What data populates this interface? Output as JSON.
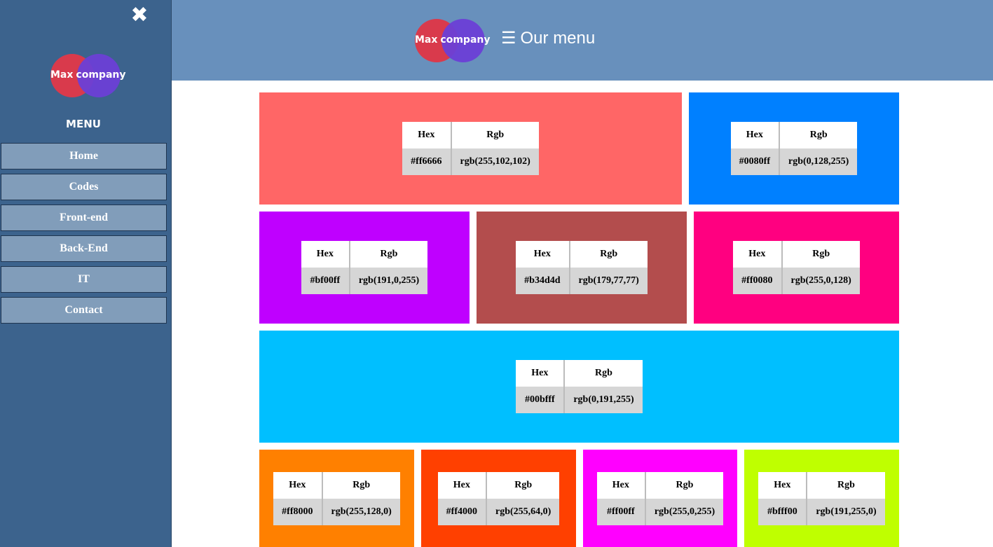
{
  "sidebar": {
    "close_icon": "✖",
    "logo": {
      "word1": "Max",
      "word2": "company"
    },
    "menu_title": "MENU",
    "items": [
      {
        "label": "Home"
      },
      {
        "label": "Codes"
      },
      {
        "label": "Front-end"
      },
      {
        "label": "Back-End"
      },
      {
        "label": "IT"
      },
      {
        "label": "Contact"
      }
    ]
  },
  "header": {
    "logo": {
      "word1": "Max",
      "word2": "company"
    },
    "menu_icon": "☰",
    "title": "Our menu"
  },
  "table_headers": {
    "hex": "Hex",
    "rgb": "Rgb"
  },
  "colors": [
    {
      "hex": "#ff6666",
      "rgb": "rgb(255,102,102)"
    },
    {
      "hex": "#0080ff",
      "rgb": "rgb(0,128,255)"
    },
    {
      "hex": "#bf00ff",
      "rgb": "rgb(191,0,255)"
    },
    {
      "hex": "#b34d4d",
      "rgb": "rgb(179,77,77)"
    },
    {
      "hex": "#ff0080",
      "rgb": "rgb(255,0,128)"
    },
    {
      "hex": "#00bfff",
      "rgb": "rgb(0,191,255)"
    },
    {
      "hex": "#ff8000",
      "rgb": "rgb(255,128,0)"
    },
    {
      "hex": "#ff4000",
      "rgb": "rgb(255,64,0)"
    },
    {
      "hex": "#ff00ff",
      "rgb": "rgb(255,0,255)"
    },
    {
      "hex": "#bfff00",
      "rgb": "rgb(191,255,0)"
    }
  ],
  "theme": {
    "sidebar_bg": "#3c638d",
    "header_bg": "#6890bc",
    "nav_item_bg": "#819dba"
  }
}
